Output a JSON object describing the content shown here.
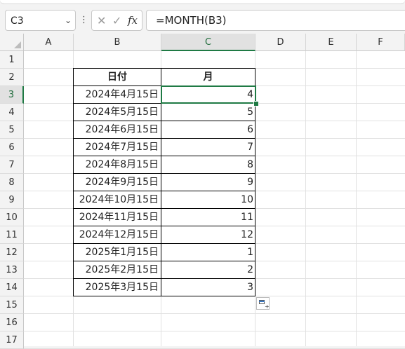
{
  "formula_bar": {
    "cell_ref": "C3",
    "more_symbol": "⋮",
    "cancel_symbol": "✕",
    "enter_symbol": "✓",
    "fx_symbol": "fx",
    "formula": "=MONTH(B3)"
  },
  "columns": [
    "A",
    "B",
    "C",
    "D",
    "E",
    "F"
  ],
  "rows": [
    "1",
    "2",
    "3",
    "4",
    "5",
    "6",
    "7",
    "8",
    "9",
    "10",
    "11",
    "12",
    "13",
    "14",
    "15",
    "16",
    "17"
  ],
  "selected": {
    "column": "C",
    "row": "3"
  },
  "table": {
    "header_date": "日付",
    "header_month": "月",
    "rows": [
      {
        "date": "2024年4月15日",
        "month": "4"
      },
      {
        "date": "2024年5月15日",
        "month": "5"
      },
      {
        "date": "2024年6月15日",
        "month": "6"
      },
      {
        "date": "2024年7月15日",
        "month": "7"
      },
      {
        "date": "2024年8月15日",
        "month": "8"
      },
      {
        "date": "2024年9月15日",
        "month": "9"
      },
      {
        "date": "2024年10月15日",
        "month": "10"
      },
      {
        "date": "2024年11月15日",
        "month": "11"
      },
      {
        "date": "2024年12月15日",
        "month": "12"
      },
      {
        "date": "2025年1月15日",
        "month": "1"
      },
      {
        "date": "2025年2月15日",
        "month": "2"
      },
      {
        "date": "2025年3月15日",
        "month": "3"
      }
    ]
  },
  "colors": {
    "accent": "#1f7a44",
    "border": "#000000"
  }
}
